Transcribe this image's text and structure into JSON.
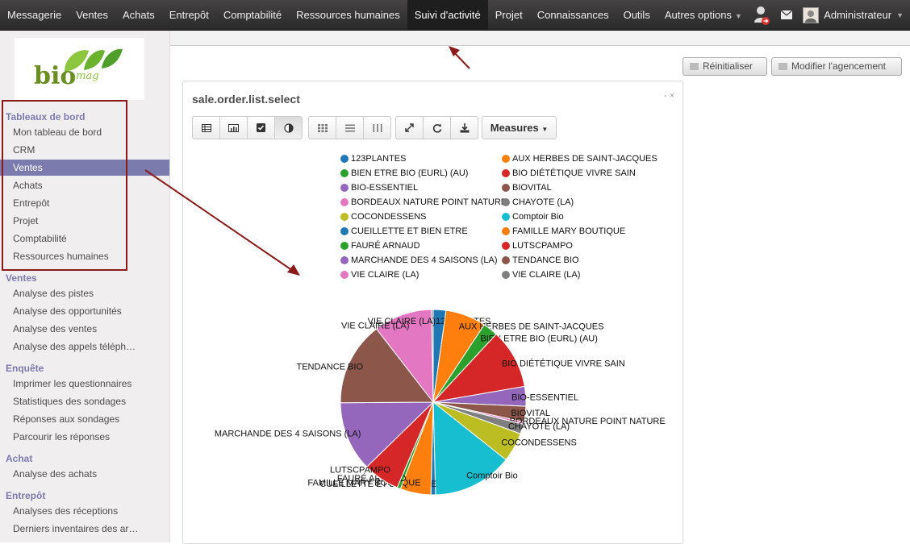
{
  "topnav": {
    "items": [
      "Messagerie",
      "Ventes",
      "Achats",
      "Entrepôt",
      "Comptabilité",
      "Ressources humaines",
      "Suivi d'activité",
      "Projet",
      "Connaissances",
      "Outils",
      "Autres options"
    ],
    "active_index": 6,
    "user_name": "Administrateur"
  },
  "sidebar": {
    "logo_text": "bio",
    "logo_sub": ".mag",
    "sections": [
      {
        "title": "Tableaux de bord",
        "items": [
          "Mon tableau de bord",
          "CRM",
          "Ventes",
          "Achats",
          "Entrepôt",
          "Projet",
          "Comptabilité",
          "Ressources humaines"
        ]
      },
      {
        "title": "Ventes",
        "items": [
          "Analyse des pistes",
          "Analyse des opportunités",
          "Analyse des ventes",
          "Analyse des appels téléph…"
        ]
      },
      {
        "title": "Enquête",
        "items": [
          "Imprimer les questionnaires",
          "Statistiques des sondages",
          "Réponses aux sondages",
          "Parcourir les réponses"
        ]
      },
      {
        "title": "Achat",
        "items": [
          "Analyse des achats"
        ]
      },
      {
        "title": "Entrepôt",
        "items": [
          "Analyses des réceptions",
          "Derniers inventaires des ar…"
        ]
      }
    ],
    "selected_item": "Ventes"
  },
  "toolbar": {
    "reset_label": "Réinitialiser",
    "layout_label": "Modifier l'agencement"
  },
  "panel": {
    "title": "sale.order.list.select",
    "controls": "- ×",
    "measures_label": "Measures"
  },
  "chart_data": {
    "type": "pie",
    "title": "",
    "series": [
      {
        "labels": [
          "123PLANTES",
          "AUX HERBES DE SAINT-JACQUES",
          "BIEN ETRE BIO (EURL) (AU)",
          "BIO DIÉTÉTIQUE VIVRE SAIN",
          "BIO-ESSENTIEL",
          "BIOVITAL",
          "BORDEAUX NATURE POINT NATURE",
          "CHAYOTE (LA)",
          "COCONDESSENS",
          "Comptoir Bio",
          "CUEILLETTE ET BIEN ETRE",
          "FAMILLE MARY BOUTIQUE",
          "FAURÉ ARNAUD",
          "LUTSCPAMPO",
          "MARCHANDE DES 4 SAISONS (LA)",
          "TENDANCE BIO",
          "VIE CLAIRE (LA)",
          "VIE CLAIRE (LA)"
        ],
        "values": [
          2.2,
          7.0,
          2.6,
          10.3,
          3.4,
          2.7,
          0.4,
          1.7,
          5.1,
          13.8,
          0.8,
          5.3,
          0.6,
          6.3,
          12.1,
          14.5,
          10.1,
          0.3
        ]
      }
    ],
    "colors": [
      "#1f77b4",
      "#ff7f0e",
      "#2ca02c",
      "#d62728",
      "#9467bd",
      "#8c564b",
      "#e377c2",
      "#7f7f7f",
      "#bcbd22",
      "#17becf",
      "#1f77b4",
      "#ff7f0e",
      "#2ca02c",
      "#d62728",
      "#9467bd",
      "#8c564b",
      "#e377c2",
      "#7f7f7f"
    ],
    "legend_placement": "top"
  }
}
